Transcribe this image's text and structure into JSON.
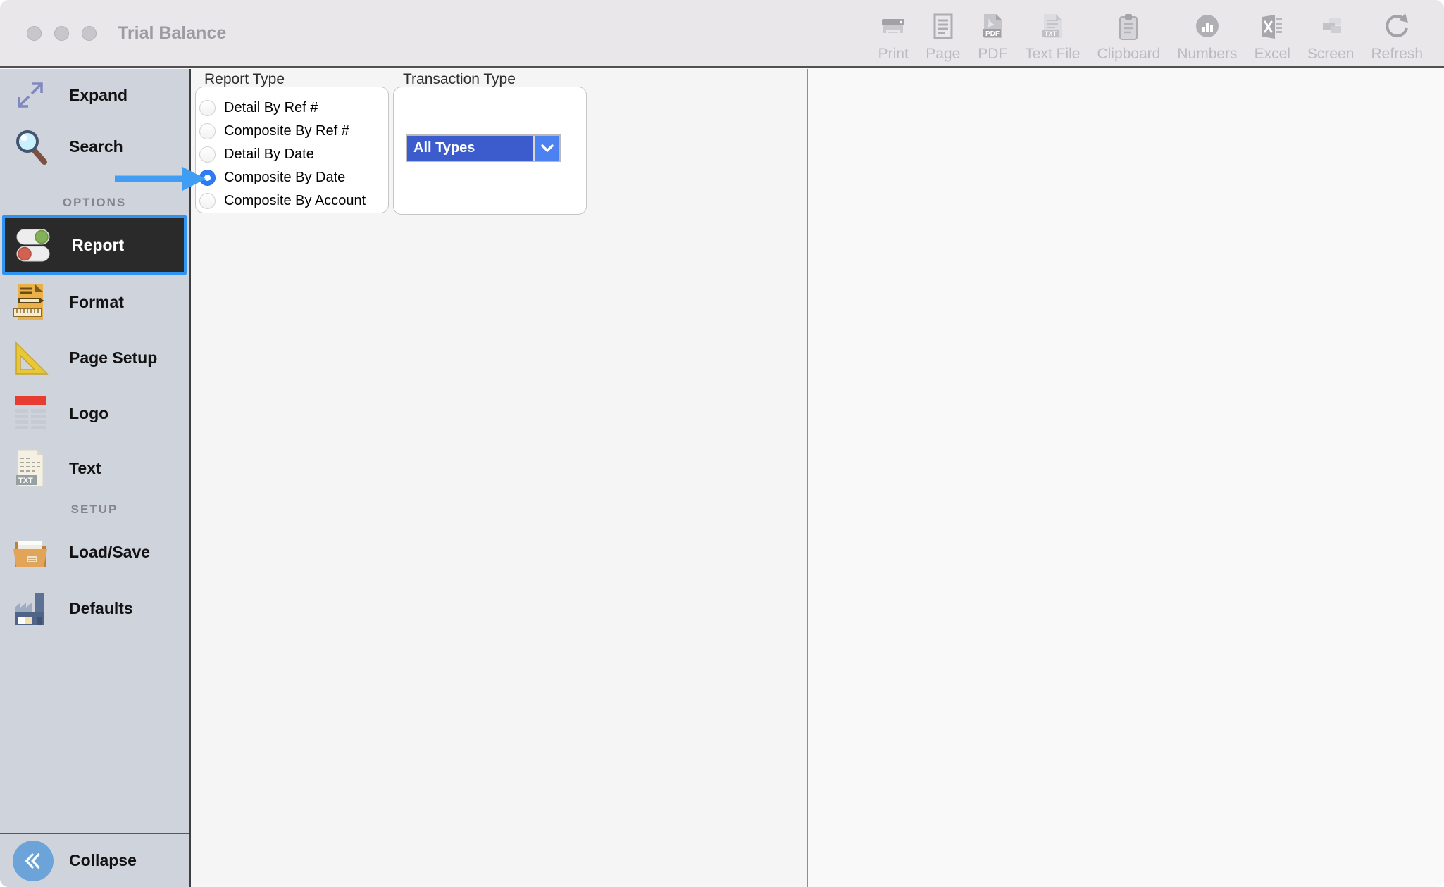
{
  "window": {
    "title": "Trial Balance"
  },
  "toolbar": {
    "items": [
      {
        "label": "Print",
        "icon": "printer-icon"
      },
      {
        "label": "Page",
        "icon": "page-icon"
      },
      {
        "label": "PDF",
        "icon": "pdf-icon",
        "badge": "PDF"
      },
      {
        "label": "Text File",
        "icon": "text-file-icon",
        "badge": "TXT"
      },
      {
        "label": "Clipboard",
        "icon": "clipboard-icon"
      },
      {
        "label": "Numbers",
        "icon": "numbers-chart-icon"
      },
      {
        "label": "Excel",
        "icon": "excel-icon"
      },
      {
        "label": "Screen",
        "icon": "screen-icon"
      },
      {
        "label": "Refresh",
        "icon": "refresh-icon"
      }
    ]
  },
  "sidebar": {
    "expand_label": "Expand",
    "search_label": "Search",
    "options_header": "OPTIONS",
    "options_items": [
      {
        "label": "Report",
        "icon": "toggles-icon",
        "selected": true
      },
      {
        "label": "Format",
        "icon": "format-document-icon",
        "selected": false
      },
      {
        "label": "Page Setup",
        "icon": "set-square-icon",
        "selected": false
      },
      {
        "label": "Logo",
        "icon": "logo-placeholder-icon",
        "selected": false
      },
      {
        "label": "Text",
        "icon": "txt-document-icon",
        "badge": "TXT",
        "selected": false
      }
    ],
    "setup_header": "SETUP",
    "setup_items": [
      {
        "label": "Load/Save",
        "icon": "folder-icon",
        "selected": false
      },
      {
        "label": "Defaults",
        "icon": "factory-icon",
        "selected": false
      }
    ],
    "collapse_label": "Collapse"
  },
  "report_panel": {
    "report_type": {
      "label": "Report Type",
      "options": [
        {
          "label": "Detail By Ref #",
          "selected": false
        },
        {
          "label": "Composite By Ref #",
          "selected": false
        },
        {
          "label": "Detail By Date",
          "selected": false
        },
        {
          "label": "Composite By Date",
          "selected": true
        },
        {
          "label": "Composite By Account",
          "selected": false
        }
      ]
    },
    "transaction_type": {
      "label": "Transaction Type",
      "value": "All Types"
    }
  },
  "annotation": {
    "arrow_points_to": "Composite By Date"
  },
  "colors": {
    "selection_border_blue": "#2f93f3",
    "annotation_arrow_blue": "#3f9ef4",
    "radio_selected_blue": "#2e7cf5",
    "dropdown_blue": "#3c5ccd",
    "dropdown_button_blue": "#4b81f1",
    "sidebar_background": "#cfd3dc",
    "selected_item_background": "#2a2a2a",
    "titlebar_background": "#e9e7ea"
  }
}
